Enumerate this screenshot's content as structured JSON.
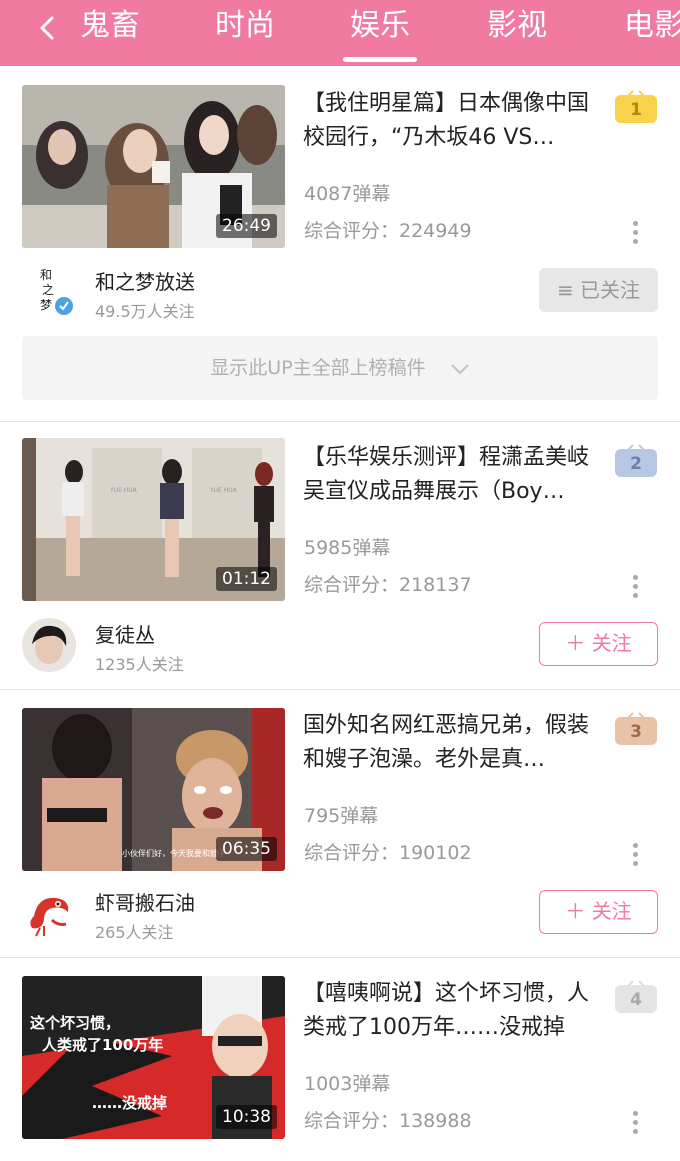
{
  "tabs": [
    {
      "label": "鬼畜"
    },
    {
      "label": "时尚"
    },
    {
      "label": "娱乐"
    },
    {
      "label": "影视"
    },
    {
      "label": "电影"
    }
  ],
  "active_tab": "娱乐",
  "colors": {
    "accent": "#f07aa0",
    "rank1": "#f8d24b",
    "rank2": "#b8c8e4",
    "rank3": "#e8c3a8",
    "rank4": "#dcdcdc"
  },
  "items": [
    {
      "rank": "1",
      "title": "【我住明星篇】日本偶像中国校园行，“乃木坂46 VS…",
      "duration": "26:49",
      "danmaku": "4087弹幕",
      "score": "综合评分：224949",
      "uploader": "和之梦放送",
      "fans": "49.5万人关注",
      "follow_label": "≡ 已关注",
      "followed": true,
      "show_all": "显示此UP主全部上榜稿件"
    },
    {
      "rank": "2",
      "title": "【乐华娱乐测评】程潇孟美岐吴宣仪成品舞展示（Boy…",
      "duration": "01:12",
      "danmaku": "5985弹幕",
      "score": "综合评分：218137",
      "uploader": "复徒丛",
      "fans": "1235人关注",
      "follow_label": "＋ 关注",
      "followed": false
    },
    {
      "rank": "3",
      "title": "国外知名网红恶搞兄弟，假装和嫂子泡澡。老外是真…",
      "duration": "06:35",
      "danmaku": "795弹幕",
      "score": "综合评分：190102",
      "uploader": "虾哥搬石油",
      "fans": "265人关注",
      "follow_label": "＋ 关注",
      "followed": false,
      "thumb_caption": "小伙伴们好，今天我要和嫂子"
    },
    {
      "rank": "4",
      "title": "【嘻咦啊说】这个坏习惯，人类戒了100万年……没戒掉",
      "duration": "10:38",
      "danmaku": "1003弹幕",
      "score": "综合评分：138988",
      "thumb_text1": "这个坏习惯，",
      "thumb_text2": "人类戒了100万年",
      "thumb_text3": "……没戒掉"
    }
  ]
}
